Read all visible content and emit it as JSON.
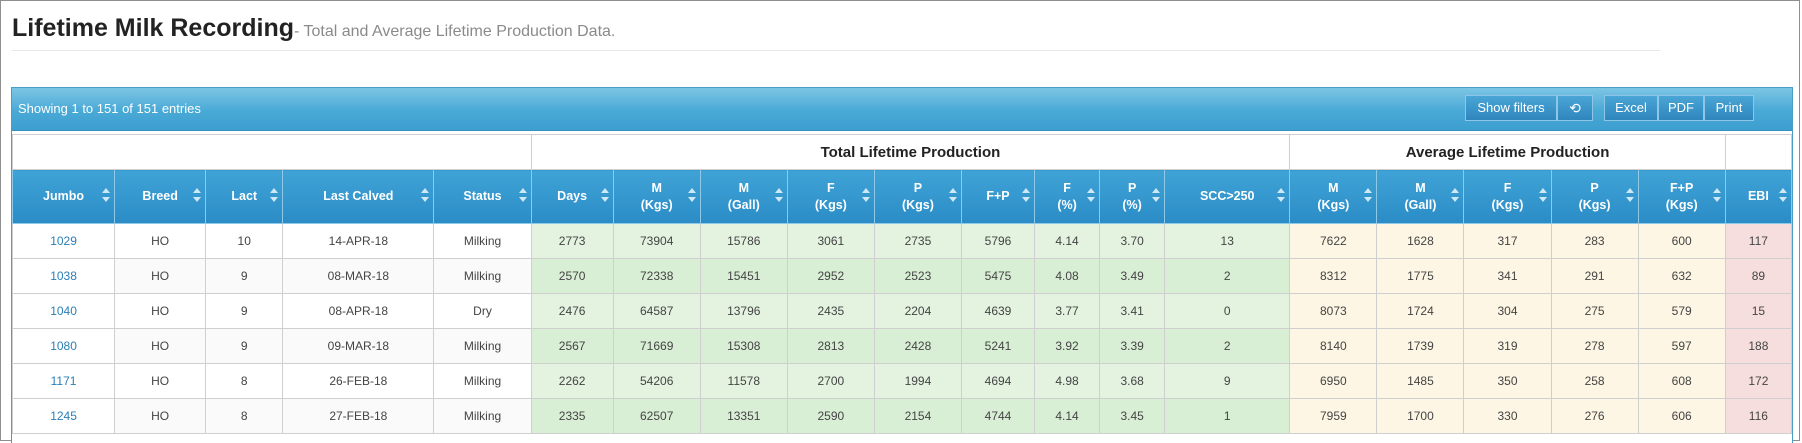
{
  "page": {
    "title": "Lifetime Milk Recording",
    "subtitle": "- Total and Average Lifetime Production Data."
  },
  "toolbar": {
    "info": "Showing 1 to 151 of 151 entries",
    "show_filters": "Show filters",
    "refresh_icon": "refresh-icon",
    "excel": "Excel",
    "pdf": "PDF",
    "print": "Print"
  },
  "groups": {
    "total": "Total Lifetime Production",
    "average": "Average Lifetime Production"
  },
  "columns": [
    {
      "l1": "Jumbo",
      "l2": ""
    },
    {
      "l1": "Breed",
      "l2": ""
    },
    {
      "l1": "Lact",
      "l2": ""
    },
    {
      "l1": "Last Calved",
      "l2": ""
    },
    {
      "l1": "Status",
      "l2": ""
    },
    {
      "l1": "Days",
      "l2": ""
    },
    {
      "l1": "M",
      "l2": "(Kgs)"
    },
    {
      "l1": "M",
      "l2": "(Gall)"
    },
    {
      "l1": "F",
      "l2": "(Kgs)"
    },
    {
      "l1": "P",
      "l2": "(Kgs)"
    },
    {
      "l1": "F+P",
      "l2": ""
    },
    {
      "l1": "F",
      "l2": "(%)"
    },
    {
      "l1": "P",
      "l2": "(%)"
    },
    {
      "l1": "SCC>250",
      "l2": ""
    },
    {
      "l1": "M",
      "l2": "(Kgs)"
    },
    {
      "l1": "M",
      "l2": "(Gall)"
    },
    {
      "l1": "F",
      "l2": "(Kgs)"
    },
    {
      "l1": "P",
      "l2": "(Kgs)"
    },
    {
      "l1": "F+P",
      "l2": "(Kgs)"
    },
    {
      "l1": "EBI",
      "l2": ""
    }
  ],
  "rows": [
    [
      "1029",
      "HO",
      "10",
      "14-APR-18",
      "Milking",
      "2773",
      "73904",
      "15786",
      "3061",
      "2735",
      "5796",
      "4.14",
      "3.70",
      "13",
      "7622",
      "1628",
      "317",
      "283",
      "600",
      "117"
    ],
    [
      "1038",
      "HO",
      "9",
      "08-MAR-18",
      "Milking",
      "2570",
      "72338",
      "15451",
      "2952",
      "2523",
      "5475",
      "4.08",
      "3.49",
      "2",
      "8312",
      "1775",
      "341",
      "291",
      "632",
      "89"
    ],
    [
      "1040",
      "HO",
      "9",
      "08-APR-18",
      "Dry",
      "2476",
      "64587",
      "13796",
      "2435",
      "2204",
      "4639",
      "3.77",
      "3.41",
      "0",
      "8073",
      "1724",
      "304",
      "275",
      "579",
      "15"
    ],
    [
      "1080",
      "HO",
      "9",
      "09-MAR-18",
      "Milking",
      "2567",
      "71669",
      "15308",
      "2813",
      "2428",
      "5241",
      "3.92",
      "3.39",
      "2",
      "8140",
      "1739",
      "319",
      "278",
      "597",
      "188"
    ],
    [
      "1171",
      "HO",
      "8",
      "26-FEB-18",
      "Milking",
      "2262",
      "54206",
      "11578",
      "2700",
      "1994",
      "4694",
      "4.98",
      "3.68",
      "9",
      "6950",
      "1485",
      "350",
      "258",
      "608",
      "172"
    ],
    [
      "1245",
      "HO",
      "8",
      "27-FEB-18",
      "Milking",
      "2335",
      "62507",
      "13351",
      "2590",
      "2154",
      "4744",
      "4.14",
      "3.45",
      "1",
      "7959",
      "1700",
      "330",
      "276",
      "606",
      "116"
    ]
  ],
  "colors": {
    "header_blue": "#2b8cc6",
    "total_green": "#d9efd5",
    "avg_yellow": "#fdf6e4",
    "ebi_red": "#f7dede",
    "link_blue": "#2a7fb8"
  }
}
